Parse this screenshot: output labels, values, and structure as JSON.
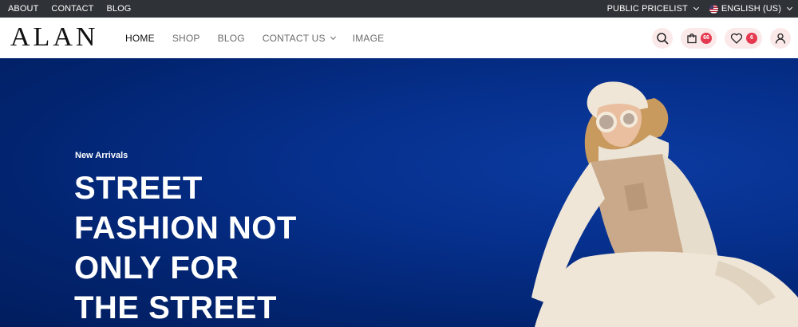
{
  "topbar": {
    "links": [
      "ABOUT",
      "CONTACT",
      "BLOG"
    ],
    "pricelist": "PUBLIC PRICELIST",
    "language": "ENGLISH (US)"
  },
  "header": {
    "logo": "ALAN",
    "nav": {
      "home": "HOME",
      "shop": "SHOP",
      "blog": "BLOG",
      "contact": "CONTACT US",
      "image": "IMAGE"
    },
    "cart_count": "66",
    "wishlist_count": "6",
    "icons": [
      "search-icon",
      "cart-icon",
      "heart-icon",
      "user-icon"
    ]
  },
  "hero": {
    "eyebrow": "New Arrivals",
    "title_lines": [
      "STREET",
      "FASHION NOT",
      "ONLY FOR",
      "THE STREET"
    ]
  },
  "colors": {
    "topbar_bg": "#2f3237",
    "hero_bg": "#022470",
    "accent": "#e53950",
    "icon_bg": "#fbe9ea"
  }
}
